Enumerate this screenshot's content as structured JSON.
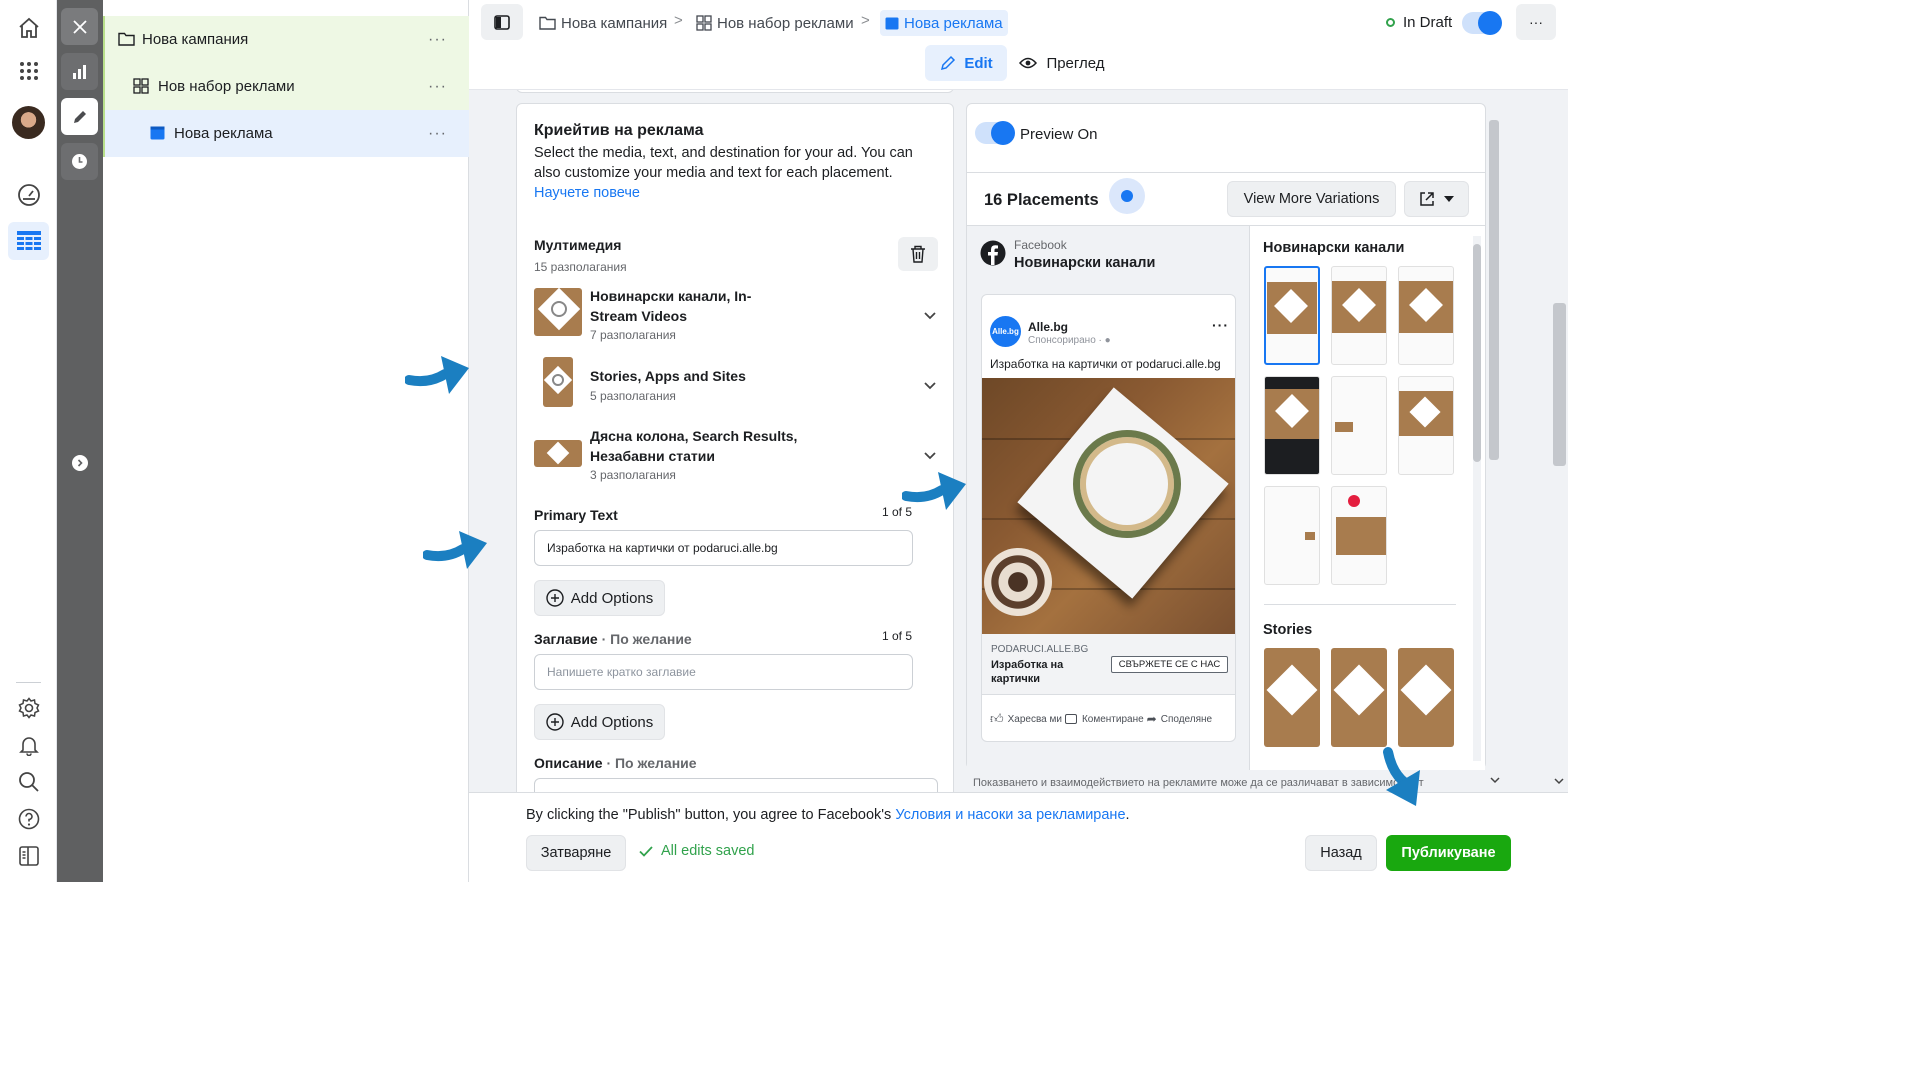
{
  "breadcrumb": {
    "campaign": "Нова кампания",
    "adset": "Нов набор реклами",
    "ad": "Нова реклама"
  },
  "status": {
    "label": "In Draft",
    "dot_color": "#31a24c"
  },
  "toolbar": {
    "edit": "Edit",
    "preview": "Преглед",
    "more": "···"
  },
  "tree": {
    "campaign": "Нова кампания",
    "adset": "Нов набор реклами",
    "ad": "Нова реклама",
    "more": "···"
  },
  "creative": {
    "title": "Криейтив на реклама",
    "desc": "Select the media, text, and destination for your ad. You can also customize your media and text for each placement.",
    "learn_more": "Научете повече",
    "media_title": "Мултимедия",
    "media_count": "15 разполагания",
    "groups": [
      {
        "name": "Новинарски канали, In-Stream Videos",
        "count": "7 разполагания"
      },
      {
        "name": "Stories, Apps and Sites",
        "count": "5 разполагания"
      },
      {
        "name": "Дясна колона, Search Results, Незабавни статии",
        "count": "3 разполагания"
      }
    ],
    "primary_label": "Primary Text",
    "primary_counter": "1 of 5",
    "primary_value": "Изработка на картички от podaruci.alle.bg",
    "add_options": "Add Options",
    "headline_label": "Заглавие",
    "headline_optional": "· По желание",
    "headline_counter": "1 of 5",
    "headline_placeholder": "Напишете кратко заглавие",
    "desc_label": "Описание",
    "desc_optional": "· По желание"
  },
  "preview": {
    "toggle_label": "Preview On",
    "placements": "16 Placements",
    "variations": "View More Variations",
    "platform": "Facebook",
    "placement_name": "Новинарски канали",
    "page": "Alle.bg",
    "page_logo": "Alle.bg",
    "sponsored": "Спонсорирано · ",
    "post_text": "Изработка на картички от podaruci.alle.bg",
    "link_domain": "PODARUCI.ALLE.BG",
    "link_title": "Изработка на картички",
    "cta": "СВЪРЖЕТЕ СЕ С НАС",
    "like": "Харесва ми",
    "comment": "Коментиране",
    "share": "Споделяне",
    "side_feeds": "Новинарски канали",
    "side_stories": "Stories",
    "disclaimer": "Показването и взаимодействието на рекламите може да се различават в зависимост от"
  },
  "footer": {
    "agree": "By clicking the \"Publish\" button, you agree to Facebook's ",
    "terms": "Условия и насоки за рекламиране",
    "dot": ".",
    "close": "Затваряне",
    "saved": "All edits saved",
    "back": "Назад",
    "publish": "Публикуване"
  },
  "colors": {
    "accent": "#1877f2",
    "publish": "#19a80f",
    "annotation": "#1b7fc1"
  }
}
